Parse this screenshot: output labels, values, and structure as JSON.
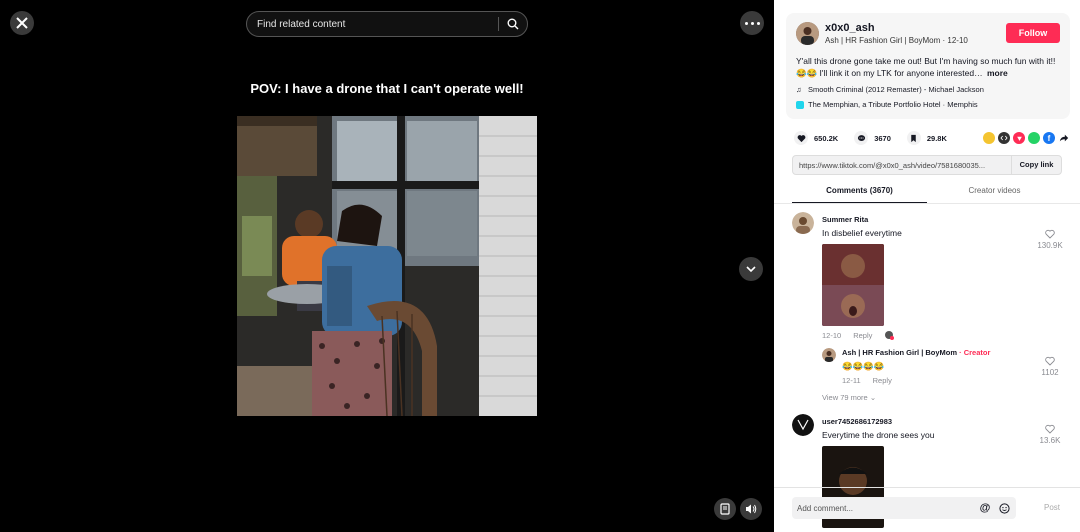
{
  "search": {
    "placeholder": "Find related content"
  },
  "video": {
    "caption": "POV: I have a drone that I can't operate well!"
  },
  "author": {
    "username": "x0x0_ash",
    "subtitle": "Ash | HR Fashion Girl | BoyMom · 12-10",
    "follow_label": "Follow",
    "description": "Y'all this drone gone take me out! But I'm having so much fun with it!! 😂😂 I'll link it on my LTK for anyone interested…",
    "more_label": "more",
    "music": "Smooth Criminal (2012 Remaster) - Michael Jackson",
    "location": "The Memphian, a Tribute Portfolio Hotel · Memphis"
  },
  "stats": {
    "likes": "650.2K",
    "comments": "3670",
    "saves": "29.8K"
  },
  "share_icons": [
    "embed-icon",
    "code-icon",
    "send-icon",
    "whatsapp-icon",
    "facebook-icon",
    "share-arrow-icon"
  ],
  "link": {
    "url": "https://www.tiktok.com/@x0x0_ash/video/7581680035...",
    "copy_label": "Copy link"
  },
  "tabs": [
    {
      "label": "Comments (3670)",
      "active": true
    },
    {
      "label": "Creator videos",
      "active": false
    }
  ],
  "comments": [
    {
      "user": "Summer Rita",
      "text": "In disbelief everytime",
      "date": "12-10",
      "reply_label": "Reply",
      "likes": "130.9K",
      "reply": {
        "user": "Ash | HR Fashion Girl | BoyMom",
        "badge": "· Creator",
        "text": "😂😂😂😂",
        "date": "12-11",
        "reply_label": "Reply",
        "likes": "1102"
      },
      "view_more": "View 79 more"
    },
    {
      "user": "user7452686172983",
      "text": "Everytime the drone sees you",
      "likes": "13.6K"
    }
  ],
  "comment_input": {
    "placeholder": "Add comment...",
    "post_label": "Post"
  },
  "colors": {
    "accent": "#fe2c55",
    "panel_bg": "#ffffff",
    "video_bg": "#000000"
  }
}
